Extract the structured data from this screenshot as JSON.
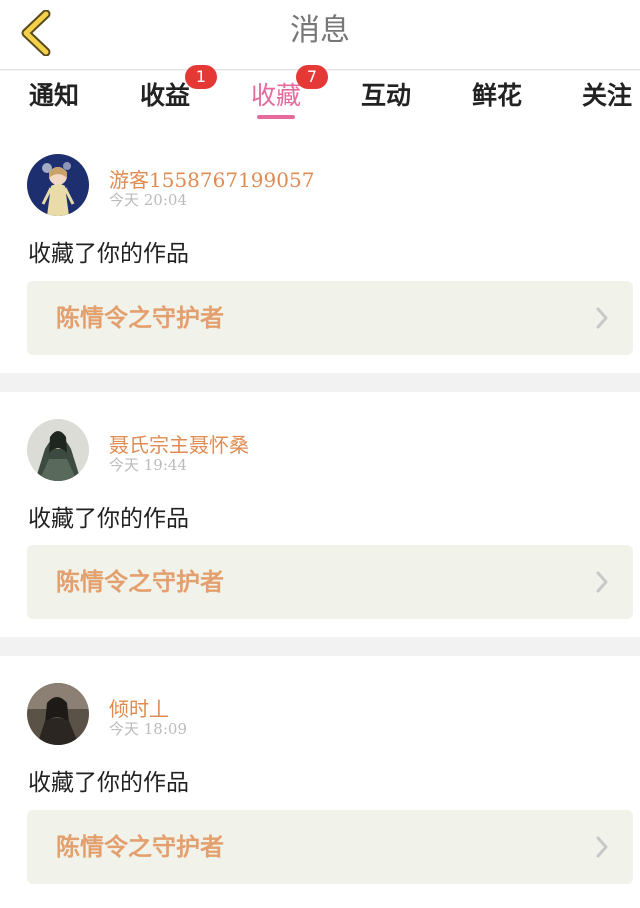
{
  "header": {
    "title": "消息",
    "back_icon": "chevron-left-icon"
  },
  "tabs": [
    {
      "label": "通知",
      "badge": ""
    },
    {
      "label": "收益",
      "badge": "1"
    },
    {
      "label": "收藏",
      "badge": "7",
      "active": true
    },
    {
      "label": "互动",
      "badge": ""
    },
    {
      "label": "鲜花",
      "badge": ""
    },
    {
      "label": "关注",
      "badge": ""
    }
  ],
  "colors": {
    "accent": "#e56a9d",
    "username": "#e08b52",
    "badge": "#e53935",
    "work_bg": "#f1f3eb",
    "work_text": "#e3a06e"
  },
  "messages": [
    {
      "username": "游客1558767199057",
      "time": "今天  20:04",
      "action": "收藏了你的作品",
      "work_title": "陈情令之守护者"
    },
    {
      "username": "聂氏宗主聂怀桑",
      "time": "今天  19:44",
      "action": "收藏了你的作品",
      "work_title": "陈情令之守护者"
    },
    {
      "username": "倾时丄",
      "time": "今天  18:09",
      "action": "收藏了你的作品",
      "work_title": "陈情令之守护者"
    }
  ]
}
